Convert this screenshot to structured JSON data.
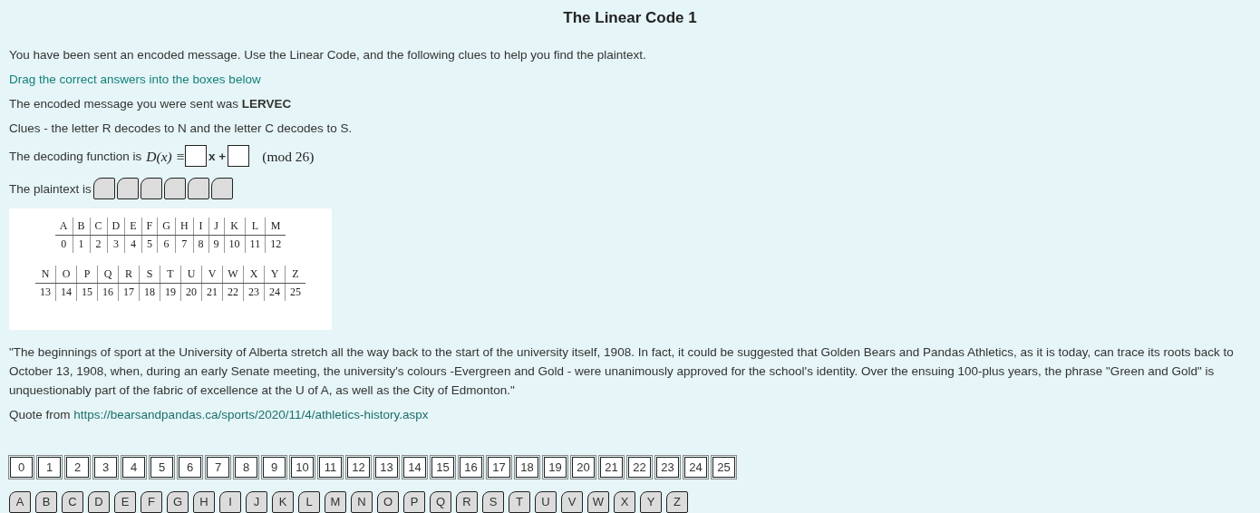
{
  "title": "The Linear Code 1",
  "intro": "You have been sent an encoded message. Use the Linear Code, and the following clues to help you find the plaintext.",
  "instruction": "Drag the correct answers into the boxes below",
  "encoded_message": "The encoded message you were sent was **LERVEC**",
  "clues": "Clues - the letter R decodes to N and the letter C decodes to S.",
  "decoding_function": {
    "label": "The decoding function is",
    "lhs": "D(x) ≡",
    "slots": [
      {
        "filled": false
      },
      {
        "filled": false
      }
    ],
    "middle": "x +",
    "modulus": "(mod 26)"
  },
  "plaintext": {
    "label": "The plaintext is",
    "slots": [
      {
        "filled": false
      },
      {
        "filled": false
      },
      {
        "filled": false
      },
      {
        "filled": false
      },
      {
        "filled": false
      },
      {
        "filled": false
      }
    ]
  },
  "code_table": [
    {
      "letters": [
        "A",
        "B",
        "C",
        "D",
        "E",
        "F",
        "G",
        "H",
        "I",
        "J",
        "K",
        "L",
        "M"
      ],
      "numbers": [
        "0",
        "1",
        "2",
        "3",
        "4",
        "5",
        "6",
        "7",
        "8",
        "9",
        "10",
        "11",
        "12"
      ]
    },
    {
      "letters": [
        "N",
        "O",
        "P",
        "Q",
        "R",
        "S",
        "T",
        "U",
        "V",
        "W",
        "X",
        "Y",
        "Z"
      ],
      "numbers": [
        "13",
        "14",
        "15",
        "16",
        "17",
        "18",
        "19",
        "20",
        "21",
        "22",
        "23",
        "24",
        "25"
      ]
    }
  ],
  "quote": "\"The beginnings of sport at the University of Alberta stretch all the way back to the start of the university itself, 1908. In fact, it could be suggested that Golden Bears and Pandas Athletics, as it is today, can trace its roots back to October 13, 1908, when, during an early Senate meeting, the university's colours -Evergreen and Gold - were unanimously approved for the school's identity. Over the ensuing 100-plus years, the phrase \"Green and Gold\" is unquestionably part of the fabric of excellence at the U of A, as well as the City of Edmonton.\"",
  "source": {
    "label": "Quote from",
    "link": "https://bearsandpandas.ca/sports/2020/11/4/athletics-history.aspx"
  },
  "number_tiles": [
    "0",
    "1",
    "2",
    "3",
    "4",
    "5",
    "6",
    "7",
    "8",
    "9",
    "10",
    "11",
    "12",
    "13",
    "14",
    "15",
    "16",
    "17",
    "18",
    "19",
    "20",
    "21",
    "22",
    "23",
    "24",
    "25"
  ],
  "letter_tiles": [
    "A",
    "B",
    "C",
    "D",
    "E",
    "F",
    "G",
    "H",
    "I",
    "J",
    "K",
    "L",
    "M",
    "N",
    "O",
    "P",
    "Q",
    "R",
    "S",
    "T",
    "U",
    "V",
    "W",
    "X",
    "Y",
    "Z"
  ]
}
